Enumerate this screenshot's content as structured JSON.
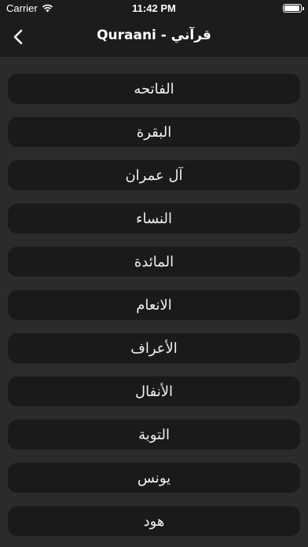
{
  "status": {
    "carrier": "Carrier",
    "time": "11:42 PM"
  },
  "nav": {
    "title": "Quraani - قرآني"
  },
  "surahs": [
    {
      "label": "الفاتحه"
    },
    {
      "label": "البقرة"
    },
    {
      "label": "آل عمران"
    },
    {
      "label": "النساء"
    },
    {
      "label": "المائدة"
    },
    {
      "label": "الانعام"
    },
    {
      "label": "الأعراف"
    },
    {
      "label": "الأنفال"
    },
    {
      "label": "التوبة"
    },
    {
      "label": "يونس"
    },
    {
      "label": "هود"
    }
  ]
}
